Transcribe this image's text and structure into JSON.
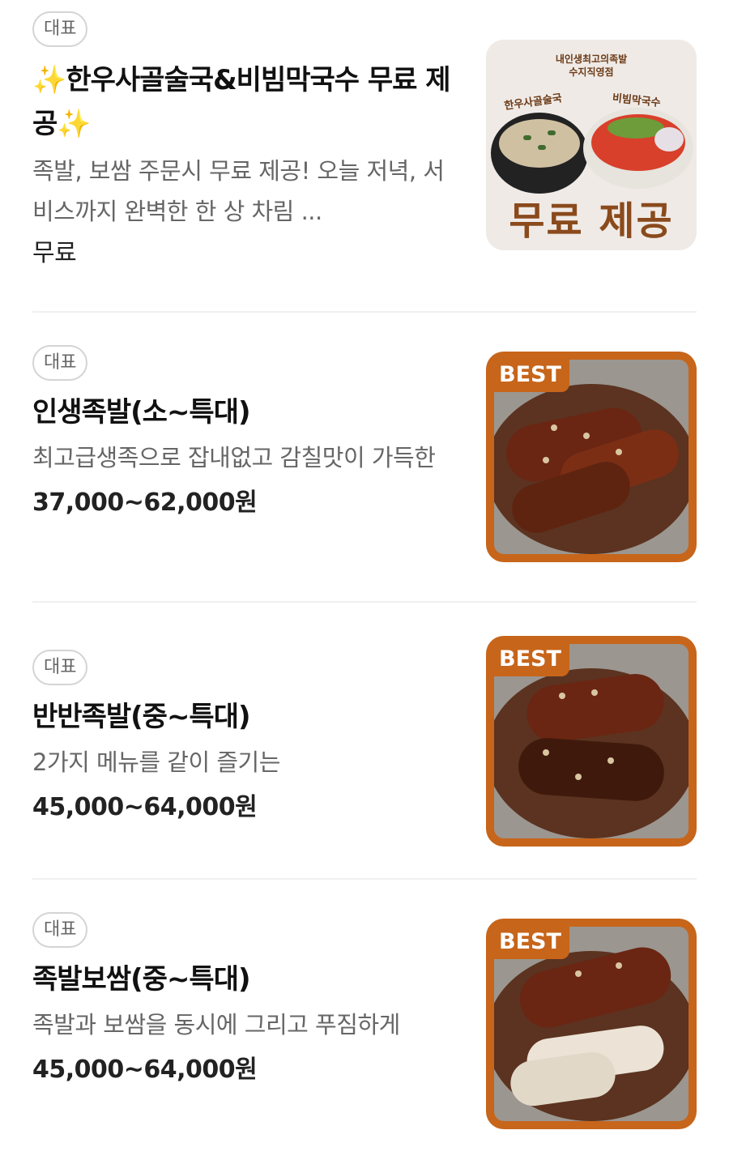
{
  "items": [
    {
      "badge": "대표",
      "title": "✨한우사골술국&비빔막국수 무료 제공✨",
      "description": "족발, 보쌈 주문시 무료 제공! 오늘 저녁, 서비스까지 완벽한 한 상 차림 ...",
      "price": "무료",
      "image": {
        "top_text": "내인생최고의족발\n수지직영점",
        "left_label": "한우사골술국",
        "right_label": "비빔막국수",
        "big_text": "무료 제공"
      }
    },
    {
      "badge": "대표",
      "title": "인생족발(소~특대)",
      "description": "최고급생족으로 잡내없고 감칠맛이 가득한",
      "price": "37,000~62,000원",
      "image": {
        "tag": "BEST"
      }
    },
    {
      "badge": "대표",
      "title": "반반족발(중~특대)",
      "description": "2가지 메뉴를 같이 즐기는",
      "price": "45,000~64,000원",
      "image": {
        "tag": "BEST"
      }
    },
    {
      "badge": "대표",
      "title": "족발보쌈(중~특대)",
      "description": "족발과 보쌈을 동시에 그리고 푸짐하게",
      "price": "45,000~64,000원",
      "image": {
        "tag": "BEST"
      }
    }
  ]
}
